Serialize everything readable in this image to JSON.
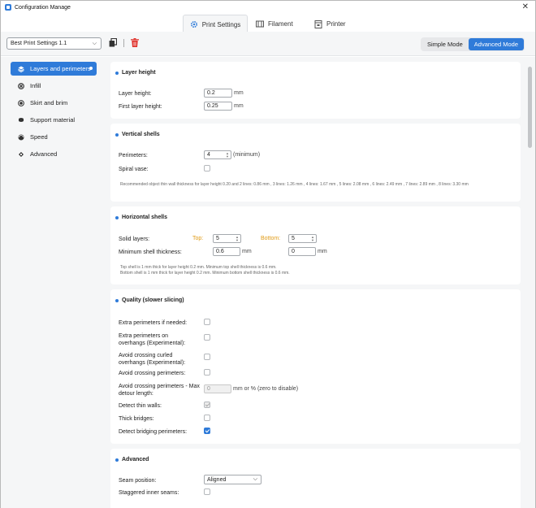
{
  "window": {
    "title": "Configuration Manage",
    "close": "✕"
  },
  "tabs": [
    {
      "label": "Print Settings",
      "icon": "gear-icon"
    },
    {
      "label": "Filament",
      "icon": "filament-icon"
    },
    {
      "label": "Printer",
      "icon": "printer-icon"
    }
  ],
  "toolbar": {
    "preset": "Best Print Settings 1.1",
    "preset_chevron": "⌵",
    "mode_simple": "Simple Mode",
    "mode_advanced": "Advanced Mode"
  },
  "sidebar": {
    "items": [
      {
        "label": "Layers and perimeters",
        "icon": "layers-icon",
        "active": true
      },
      {
        "label": "Infill",
        "icon": "infill-icon"
      },
      {
        "label": "Skirt and brim",
        "icon": "skirt-icon"
      },
      {
        "label": "Support material",
        "icon": "support-icon"
      },
      {
        "label": "Speed",
        "icon": "speed-icon"
      },
      {
        "label": "Advanced",
        "icon": "advanced-icon"
      }
    ]
  },
  "sections": {
    "layer_height": {
      "title": "Layer height",
      "layer_height_label": "Layer height:",
      "layer_height_value": "0.2",
      "first_layer_label": "First layer height:",
      "first_layer_value": "0.25",
      "unit": "mm"
    },
    "vertical_shells": {
      "title": "Vertical shells",
      "perimeters_label": "Perimeters:",
      "perimeters_value": "4",
      "perimeters_unit": "(minimum)",
      "spiral_label": "Spiral vase:",
      "note": "Recommended object thin wall thickness for layer height 0.20 and 2 lines: 0.86 mm , 3 lines: 1.26 mm , 4 lines: 1.67 mm , 5 lines: 2.08 mm , 6 lines: 2.49 mm , 7 lines: 2.89 mm , 8 lines: 3.30 mm"
    },
    "horizontal_shells": {
      "title": "Horizontal shells",
      "solid_label": "Solid layers:",
      "top_label": "Top:",
      "top_value": "5",
      "bottom_label": "Bottom:",
      "bottom_value": "5",
      "min_shell_label": "Minimum shell thickness:",
      "min_top_value": "0.6",
      "min_bottom_value": "0",
      "unit": "mm",
      "note1": "Top shell is 1 mm thick for layer height 0.2 mm. Minimum top shell thickness is 0.6 mm.",
      "note2": "Bottom shell is 1 mm thick for layer height 0.2 mm. Minimum bottom shell thickness is 0.6 mm."
    },
    "quality": {
      "title": "Quality (slower slicing)",
      "extra_perimeters": "Extra perimeters if needed:",
      "extra_overhangs": "Extra perimeters on overhangs (Experimental):",
      "avoid_curled": "Avoid crossing curled overhangs (Experimental):",
      "avoid_crossing": "Avoid crossing perimeters:",
      "avoid_max_detour": "Avoid crossing perimeters - Max detour length:",
      "max_detour_value": "0",
      "max_detour_unit": "mm or % (zero to disable)",
      "detect_thin": "Detect thin walls:",
      "thick_bridges": "Thick bridges:",
      "detect_bridging": "Detect bridging perimeters:"
    },
    "advanced": {
      "title": "Advanced",
      "seam_label": "Seam position:",
      "seam_value": "Aligned",
      "seam_chevron": "⌵",
      "staggered_label": "Staggered inner seams:"
    }
  },
  "colors": {
    "accent": "#2f7bd9",
    "danger": "#e0322c",
    "orange": "#e09a14"
  }
}
